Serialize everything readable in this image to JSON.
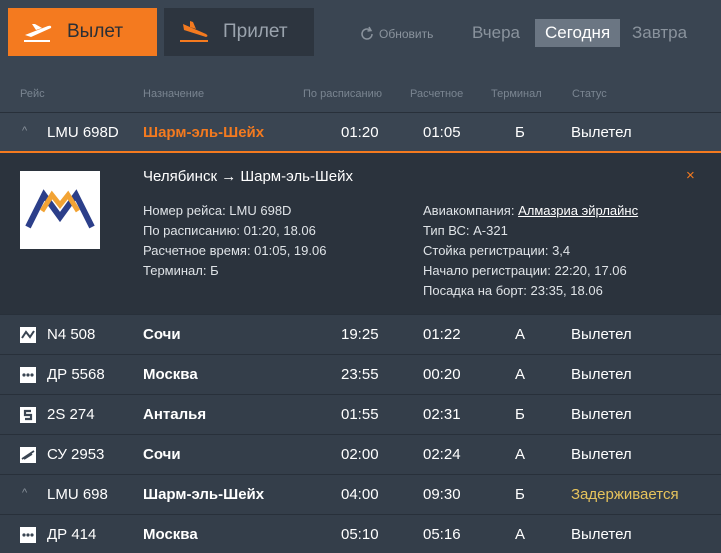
{
  "tabs": {
    "departures": "Вылет",
    "arrivals": "Прилет"
  },
  "refresh_label": "Обновить",
  "days": {
    "yesterday": "Вчера",
    "today": "Сегодня",
    "tomorrow": "Завтра"
  },
  "columns": {
    "flight": "Рейс",
    "destination": "Назначение",
    "scheduled": "По расписанию",
    "estimated": "Расчетное",
    "terminal": "Терминал",
    "status": "Статус"
  },
  "expanded_flight": {
    "flight": "LMU 698D",
    "destination": "Шарм-эль-Шейх",
    "scheduled": "01:20",
    "estimated": "01:05",
    "terminal": "Б",
    "status": "Вылетел",
    "route": "Челябинск → Шарм-эль-Шейх",
    "details_left": {
      "number": "Номер рейса: LMU 698D",
      "scheduled": "По расписанию: 01:20, 18.06",
      "estimated": "Расчетное время: 01:05, 19.06",
      "terminal": "Терминал: Б"
    },
    "details_right": {
      "airline_prefix": "Авиакомпания:",
      "airline_name": "Алмазриа эйрлайнс",
      "aircraft": "Тип ВС: А-321",
      "checkin_counter": "Стойка регистрации: 3,4",
      "checkin_start": "Начало регистрации: 22:20, 17.06",
      "boarding": "Посадка на борт: 23:35, 18.06"
    },
    "close": "×"
  },
  "flights": [
    {
      "flight": "N4 508",
      "destination": "Сочи",
      "scheduled": "19:25",
      "estimated": "01:22",
      "terminal": "А",
      "status": "Вылетел",
      "icon": "nordwind-logo-icon"
    },
    {
      "flight": "ДР 5568",
      "destination": "Москва",
      "scheduled": "23:55",
      "estimated": "00:20",
      "terminal": "А",
      "status": "Вылетел",
      "icon": "pobeda-logo-icon"
    },
    {
      "flight": "2S 274",
      "destination": "Анталья",
      "scheduled": "01:55",
      "estimated": "02:31",
      "terminal": "Б",
      "status": "Вылетел",
      "icon": "airline-s-logo-icon"
    },
    {
      "flight": "СУ 2953",
      "destination": "Сочи",
      "scheduled": "02:00",
      "estimated": "02:24",
      "terminal": "А",
      "status": "Вылетел",
      "icon": "aeroflot-logo-icon"
    },
    {
      "flight": "LMU 698",
      "destination": "Шарм-эль-Шейх",
      "scheduled": "04:00",
      "estimated": "09:30",
      "terminal": "Б",
      "status": "Задерживается",
      "icon": "chevron-up-icon"
    },
    {
      "flight": "ДР 414",
      "destination": "Москва",
      "scheduled": "05:10",
      "estimated": "05:16",
      "terminal": "А",
      "status": "Вылетел",
      "icon": "pobeda-logo-icon"
    }
  ],
  "colors": {
    "accent": "#f47a1f",
    "delayed": "#e6c35c",
    "background": "#3a4552"
  }
}
